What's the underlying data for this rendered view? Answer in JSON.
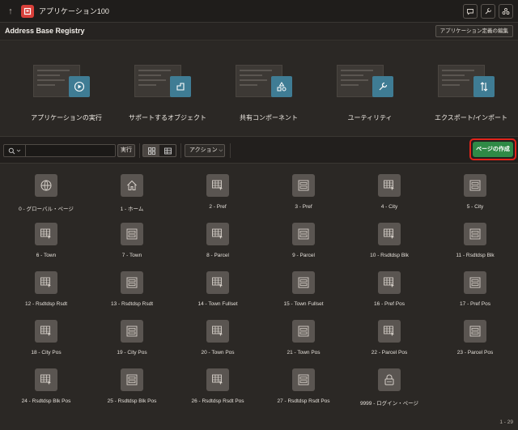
{
  "header": {
    "app_title": "アプリケーション100"
  },
  "appbar": {
    "name": "Address Base Registry",
    "edit_button": "アプリケーション定義の編集"
  },
  "features": [
    {
      "label": "アプリケーションの実行",
      "icon": "play-icon"
    },
    {
      "label": "サポートするオブジェクト",
      "icon": "object-icon"
    },
    {
      "label": "共有コンポーネント",
      "icon": "shapes-icon"
    },
    {
      "label": "ユーティリティ",
      "icon": "wrench-icon"
    },
    {
      "label": "エクスポート/インポート",
      "icon": "export-import-icon"
    }
  ],
  "toolbar": {
    "search_placeholder": "",
    "run_label": "実行",
    "action_label": "アクション",
    "create_label": "ページの作成"
  },
  "pages": [
    {
      "label": "0 - グローバル・ページ",
      "icon": "globe-icon"
    },
    {
      "label": "1 - ホーム",
      "icon": "home-icon"
    },
    {
      "label": "2 - Pref",
      "icon": "table-form-icon"
    },
    {
      "label": "3 - Pref",
      "icon": "form-icon"
    },
    {
      "label": "4 - City",
      "icon": "table-form-icon"
    },
    {
      "label": "5 - City",
      "icon": "form-icon"
    },
    {
      "label": "6 - Town",
      "icon": "table-form-icon"
    },
    {
      "label": "7 - Town",
      "icon": "form-icon"
    },
    {
      "label": "8 - Parcel",
      "icon": "table-form-icon"
    },
    {
      "label": "9 - Parcel",
      "icon": "form-icon"
    },
    {
      "label": "10 - Rsdtdsp Blk",
      "icon": "table-form-icon"
    },
    {
      "label": "11 - Rsdtdsp Blk",
      "icon": "form-icon"
    },
    {
      "label": "12 - Rsdtdsp Rsdt",
      "icon": "table-form-icon"
    },
    {
      "label": "13 - Rsdtdsp Rsdt",
      "icon": "form-icon"
    },
    {
      "label": "14 - Town Fullset",
      "icon": "table-form-icon"
    },
    {
      "label": "15 - Town Fullset",
      "icon": "form-icon"
    },
    {
      "label": "16 - Pref Pos",
      "icon": "table-form-icon"
    },
    {
      "label": "17 - Pref Pos",
      "icon": "form-icon"
    },
    {
      "label": "18 - City Pos",
      "icon": "table-form-icon"
    },
    {
      "label": "19 - City Pos",
      "icon": "form-icon"
    },
    {
      "label": "20 - Town Pos",
      "icon": "table-form-icon"
    },
    {
      "label": "21 - Town Pos",
      "icon": "form-icon"
    },
    {
      "label": "22 - Parcel Pos",
      "icon": "table-form-icon"
    },
    {
      "label": "23 - Parcel Pos",
      "icon": "form-icon"
    },
    {
      "label": "24 - Rsdtdsp Blk Pos",
      "icon": "table-form-icon"
    },
    {
      "label": "25 - Rsdtdsp Blk Pos",
      "icon": "form-icon"
    },
    {
      "label": "26 - Rsdtdsp Rsdt Pos",
      "icon": "table-form-icon"
    },
    {
      "label": "27 - Rsdtdsp Rsdt Pos",
      "icon": "form-icon"
    },
    {
      "label": "9999 - ログイン・ページ",
      "icon": "lock-icon"
    }
  ],
  "footer": {
    "range": "1 - 29"
  },
  "colors": {
    "accent_create": "#2f8a46",
    "highlight_border": "#e0231a",
    "feature_badge": "#3f7c94"
  }
}
